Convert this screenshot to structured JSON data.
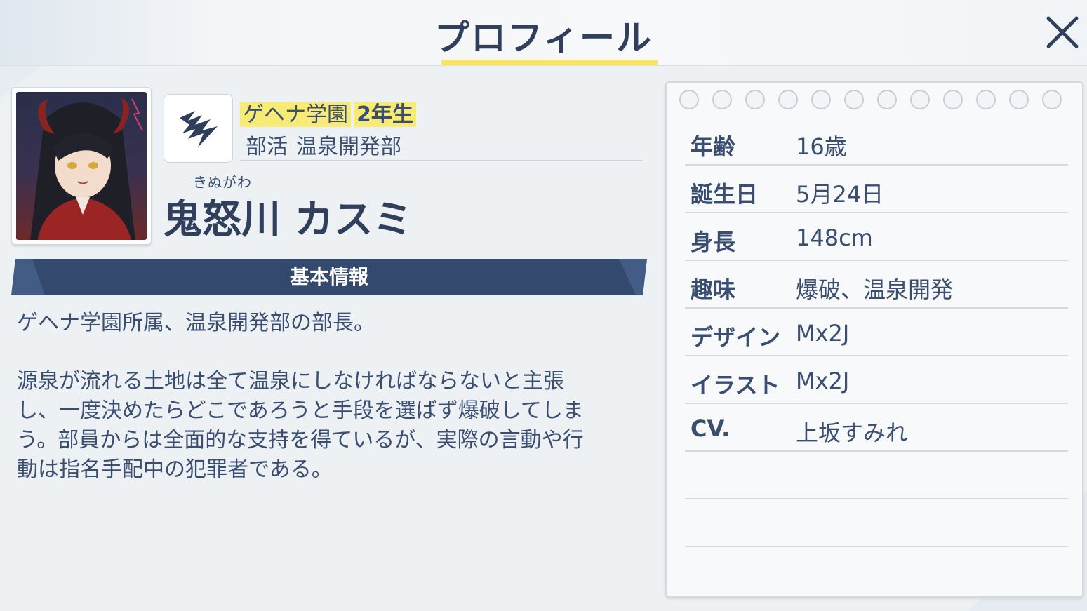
{
  "header": {
    "title": "プロフィール",
    "accent_color": "#f5e66a"
  },
  "character": {
    "school": "ゲヘナ学園",
    "grade": "2年生",
    "club_label": "部活",
    "club": "温泉開発部",
    "furigana": "きぬがわ",
    "name": "鬼怒川 カスミ"
  },
  "section": {
    "title": "基本情報",
    "bar_color": "#34496e"
  },
  "description": {
    "intro": "ゲヘナ学園所属、温泉開発部の部長。",
    "body": "源泉が流れる土地は全て温泉にしなければならないと主張\nし、一度決めたらどこであろうと手段を選ばず爆破してしま\nう。部員からは全面的な支持を得ているが、実際の言動や行\n動は指名手配中の犯罪者である。"
  },
  "profile": {
    "rows": [
      {
        "label": "年齢",
        "value": "16歳"
      },
      {
        "label": "誕生日",
        "value": "5月24日"
      },
      {
        "label": "身長",
        "value": "148cm"
      },
      {
        "label": "趣味",
        "value": "爆破、温泉開発"
      },
      {
        "label": "デザイン",
        "value": "Mx2J"
      },
      {
        "label": "イラスト",
        "value": "Mx2J"
      },
      {
        "label": "CV.",
        "value": "上坂すみれ"
      },
      {
        "label": "",
        "value": ""
      },
      {
        "label": "",
        "value": ""
      }
    ]
  },
  "icons": {
    "close": "close-icon",
    "school_emblem": "gehenna-emblem-icon",
    "portrait": "character-portrait"
  }
}
